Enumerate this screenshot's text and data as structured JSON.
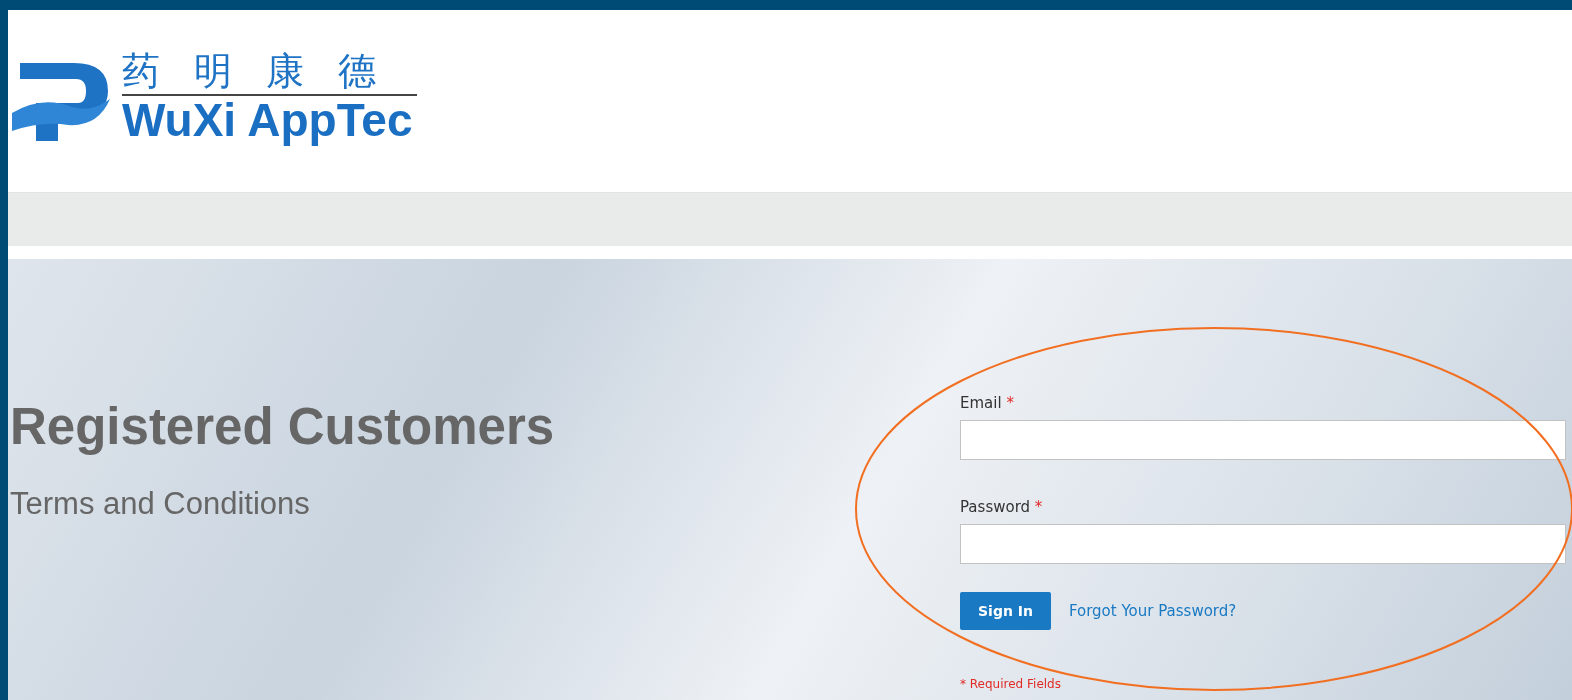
{
  "logo": {
    "chinese": "药明康德",
    "english": "WuXi AppTec"
  },
  "hero": {
    "title": "Registered Customers",
    "link": "Terms and Conditions"
  },
  "form": {
    "fields": [
      {
        "label": "Email",
        "required_mark": "*"
      },
      {
        "label": "Password",
        "required_mark": "*"
      }
    ],
    "sign_in": "Sign In",
    "forgot": "Forgot Your Password?",
    "required_note": "* Required Fields"
  }
}
